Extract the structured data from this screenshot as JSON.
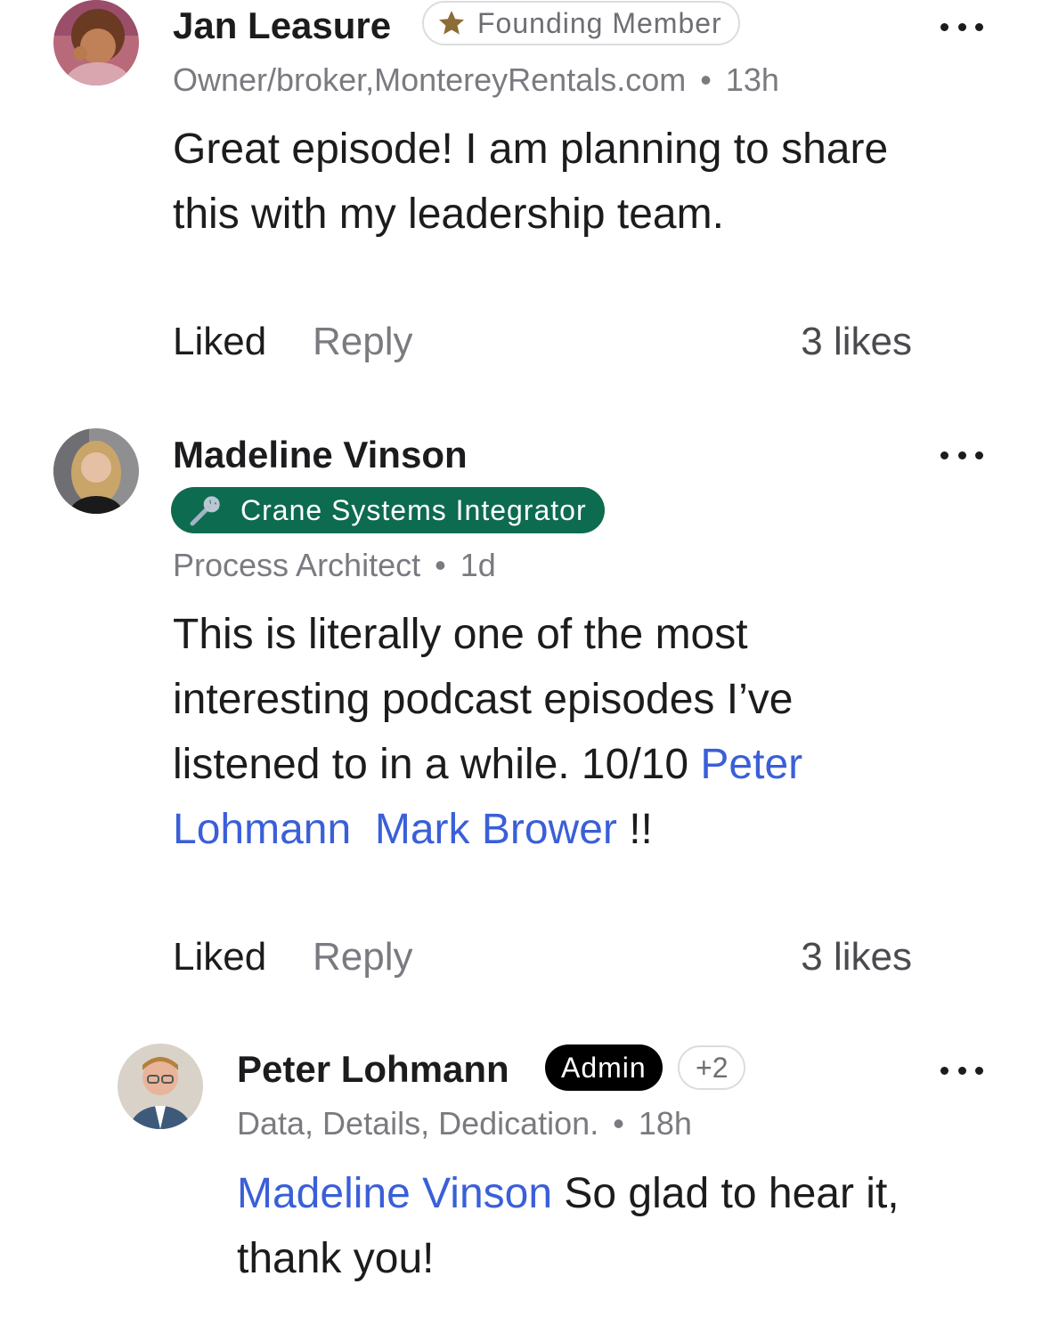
{
  "comments": [
    {
      "author": "Jan Leasure",
      "badge": "Founding Member",
      "badge_icon": "star-icon",
      "headline": "Owner/broker,MontereyRentals.com",
      "separator": "•",
      "time": "13h",
      "text": "Great episode!  I am planning to share this with my leadership team.",
      "liked_label": "Liked",
      "reply_label": "Reply",
      "likes": "3 likes"
    },
    {
      "author": "Madeline Vinson",
      "badge": "Crane Systems Integrator",
      "badge_icon": "wrench-icon",
      "badge_color": "#0d6b4f",
      "headline": "Process Architect",
      "separator": "•",
      "time": "1d",
      "text_before": "This is literally one of the most interesting podcast episodes I’ve listened to in a while. 10/10 ",
      "mention_1": "Peter Lohmann",
      "mention_gap": "  ",
      "mention_2": "Mark Brower",
      "text_after": " !!",
      "liked_label": "Liked",
      "reply_label": "Reply",
      "likes": "3 likes"
    },
    {
      "author": "Peter Lohmann",
      "badge": "Admin",
      "extra_badges": "+2",
      "headline": "Data, Details, Dedication.",
      "separator": "•",
      "time": "18h",
      "mention": "Madeline Vinson",
      "text_after": " So glad to hear it, thank you!"
    }
  ],
  "colors": {
    "mention": "#3a5fd8",
    "text": "#1c1c1e",
    "muted": "#7a7a80",
    "green_badge": "#0d6b4f"
  }
}
